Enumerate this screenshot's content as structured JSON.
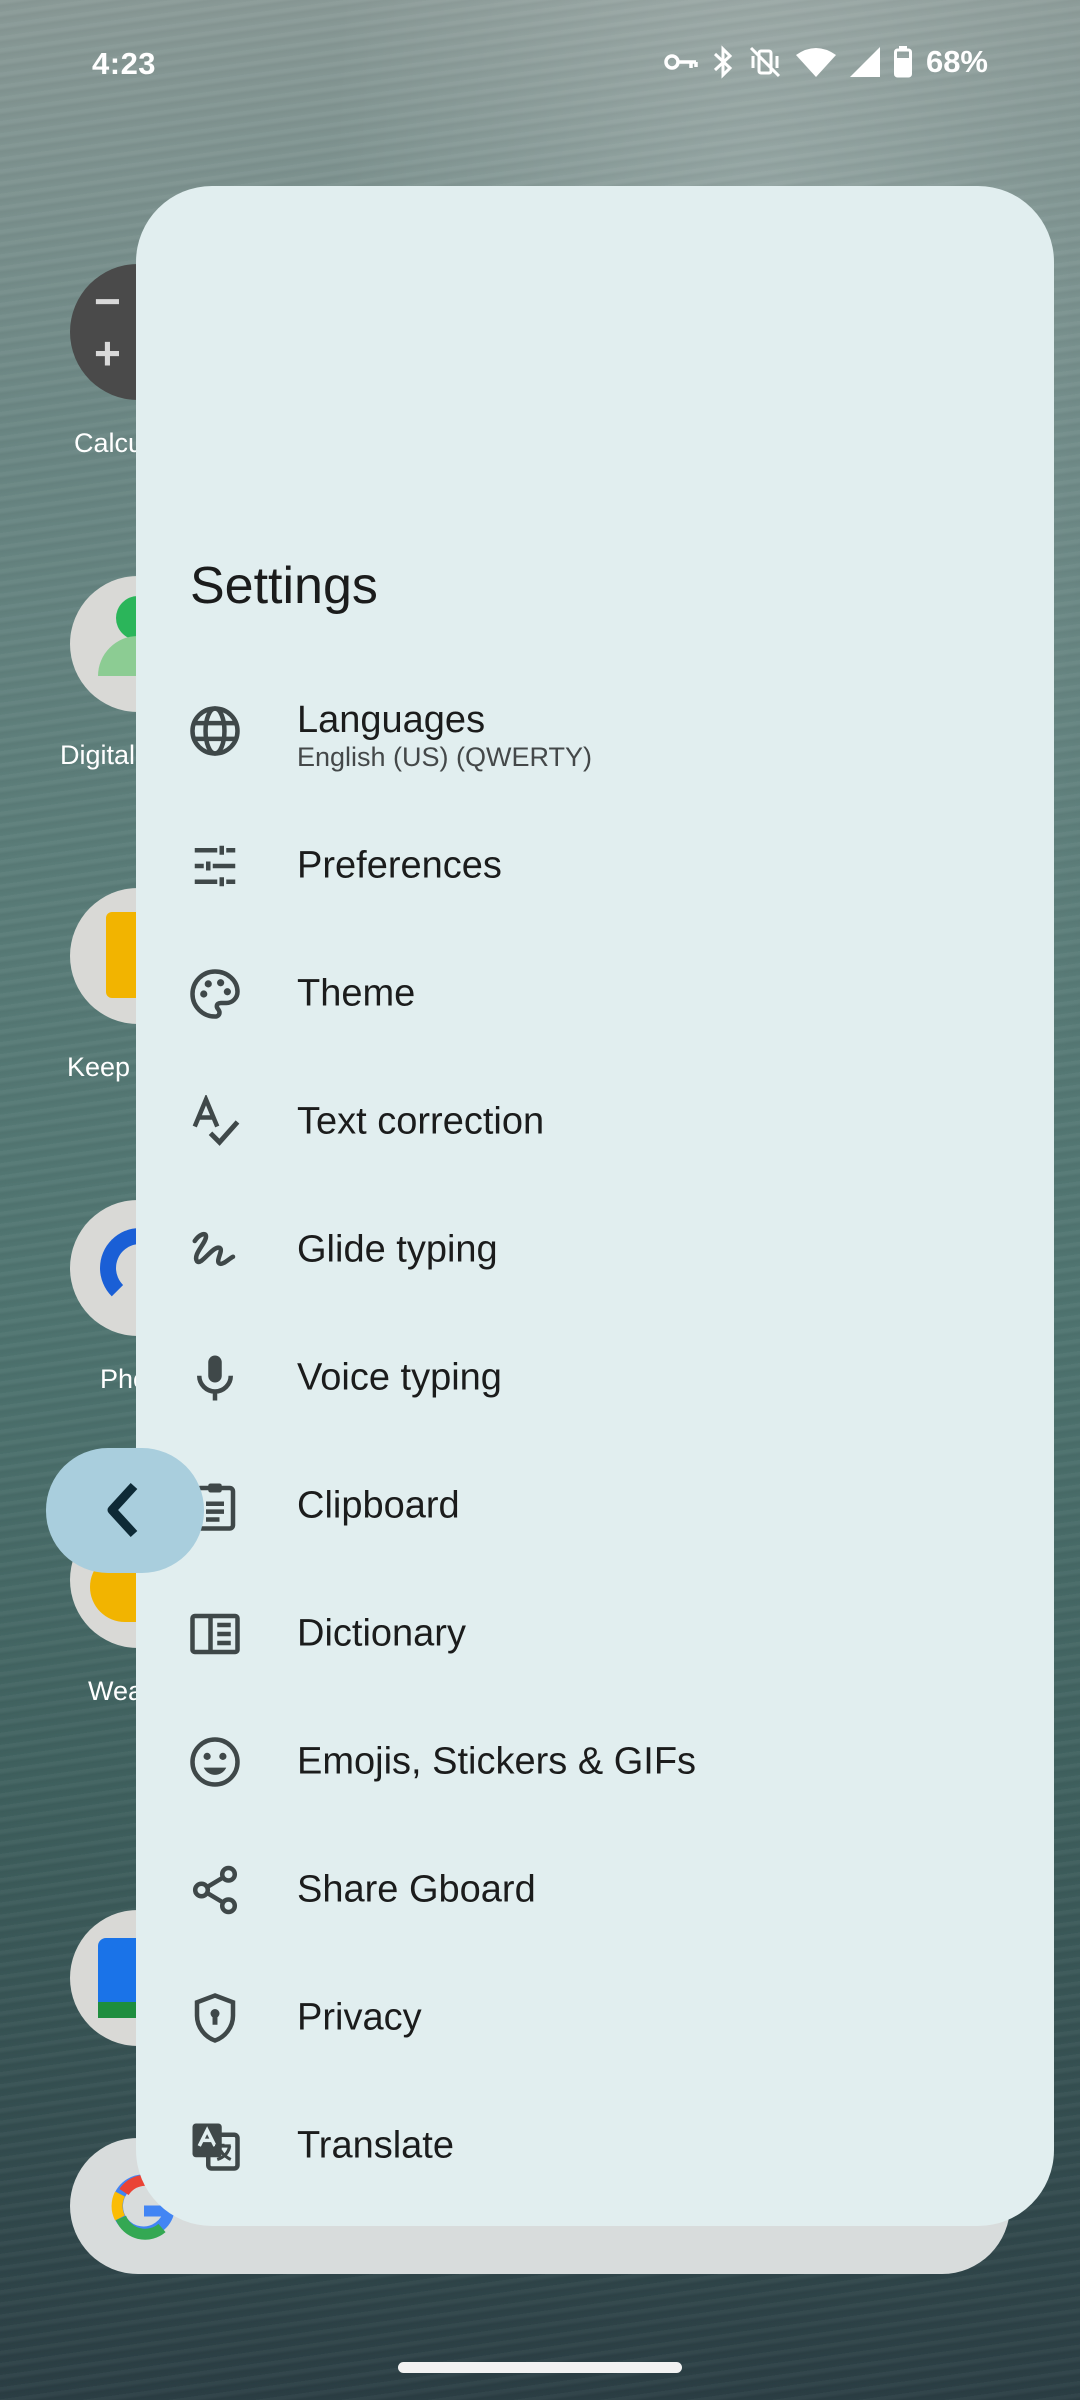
{
  "status_bar": {
    "time": "4:23",
    "battery_percent": "68%",
    "icons": [
      "vpn-key-icon",
      "bluetooth-icon",
      "vibrate-off-icon",
      "wifi-icon",
      "signal-icon",
      "battery-icon"
    ]
  },
  "home_apps": [
    {
      "label": "Calcu",
      "icon": "calculator-icon"
    },
    {
      "label": "Digital",
      "icon": "digital-wellbeing-icon"
    },
    {
      "label": "Keep",
      "icon": "keep-icon"
    },
    {
      "label": "Pho",
      "icon": "phone-icon"
    },
    {
      "label": "Wea",
      "icon": "weather-icon"
    },
    {
      "label": "",
      "icon": "calendar-icon"
    }
  ],
  "settings": {
    "title": "Settings",
    "items": [
      {
        "label": "Languages",
        "sublabel": "English (US) (QWERTY)",
        "icon": "globe-icon"
      },
      {
        "label": "Preferences",
        "icon": "tune-icon"
      },
      {
        "label": "Theme",
        "icon": "palette-icon"
      },
      {
        "label": "Text correction",
        "icon": "spellcheck-icon"
      },
      {
        "label": "Glide typing",
        "icon": "gesture-icon"
      },
      {
        "label": "Voice typing",
        "icon": "mic-icon"
      },
      {
        "label": "Clipboard",
        "icon": "clipboard-icon"
      },
      {
        "label": "Dictionary",
        "icon": "dictionary-icon"
      },
      {
        "label": "Emojis, Stickers & GIFs",
        "icon": "emoji-icon"
      },
      {
        "label": "Share Gboard",
        "icon": "share-icon"
      },
      {
        "label": "Privacy",
        "icon": "shield-icon"
      },
      {
        "label": "Translate",
        "icon": "translate-icon"
      }
    ]
  },
  "colors": {
    "panel_bg": "#e1eeef",
    "back_handle": "#a9cedd",
    "icon": "#3f4849",
    "text": "#1b1c1c"
  }
}
